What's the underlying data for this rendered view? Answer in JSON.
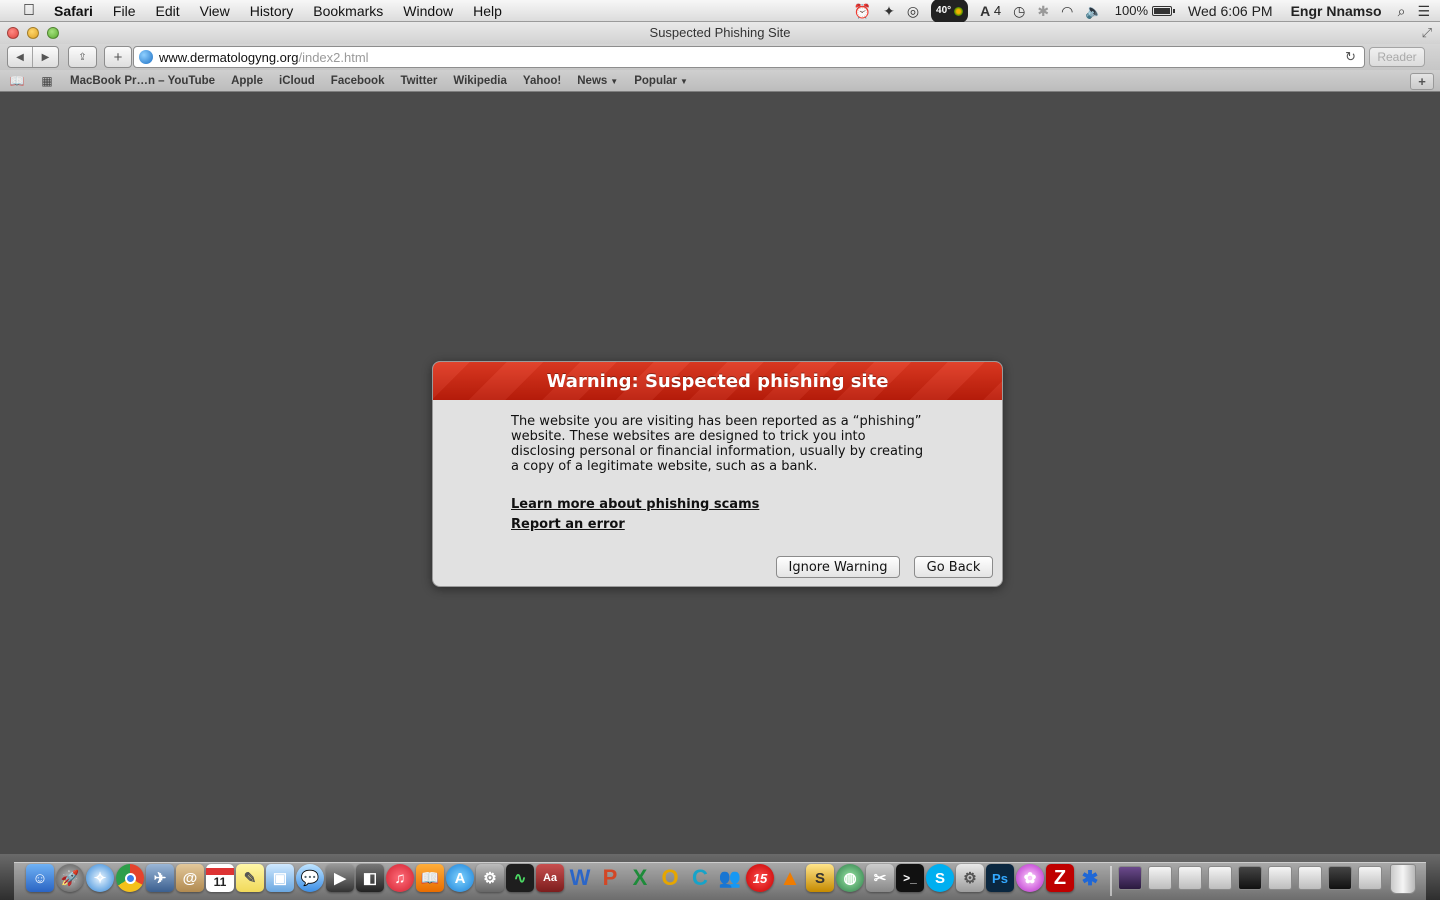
{
  "menubar": {
    "app_name": "Safari",
    "items": [
      "File",
      "Edit",
      "View",
      "History",
      "Bookmarks",
      "Window",
      "Help"
    ],
    "status": {
      "temperature": "40°",
      "adobe_count": "4",
      "battery": "100%",
      "battery_level": 1.0,
      "clock": "Wed 6:06 PM",
      "user": "Engr Nnamso"
    }
  },
  "window": {
    "title": "Suspected Phishing Site"
  },
  "toolbar": {
    "url_host": "www.dermatologyng.org",
    "url_path": "/index2.html",
    "reader_label": "Reader"
  },
  "bookmarks": {
    "items": [
      "MacBook Pr…n – YouTube",
      "Apple",
      "iCloud",
      "Facebook",
      "Twitter",
      "Wikipedia",
      "Yahoo!",
      "News",
      "Popular"
    ]
  },
  "dialog": {
    "title": "Warning: Suspected phishing site",
    "body": "The website you are visiting has been reported as a “phishing” website. These websites are designed to trick you into disclosing personal or financial information, usually by creating a copy of a legitimate website, such as a bank.",
    "learn_more": "Learn more about phishing scams",
    "report_error": "Report an error",
    "ignore_label": "Ignore Warning",
    "go_back_label": "Go Back"
  },
  "dock": {
    "badge_15": "15",
    "calendar_day": "11",
    "accent_colors": {
      "dialog_header": "#cf2a14",
      "finder": "#3d7fd9",
      "chrome": "#e4432d",
      "itunes": "#e8323c",
      "skype": "#00aff0",
      "photoshop": "#0a2740",
      "filezilla": "#bf0000"
    }
  }
}
